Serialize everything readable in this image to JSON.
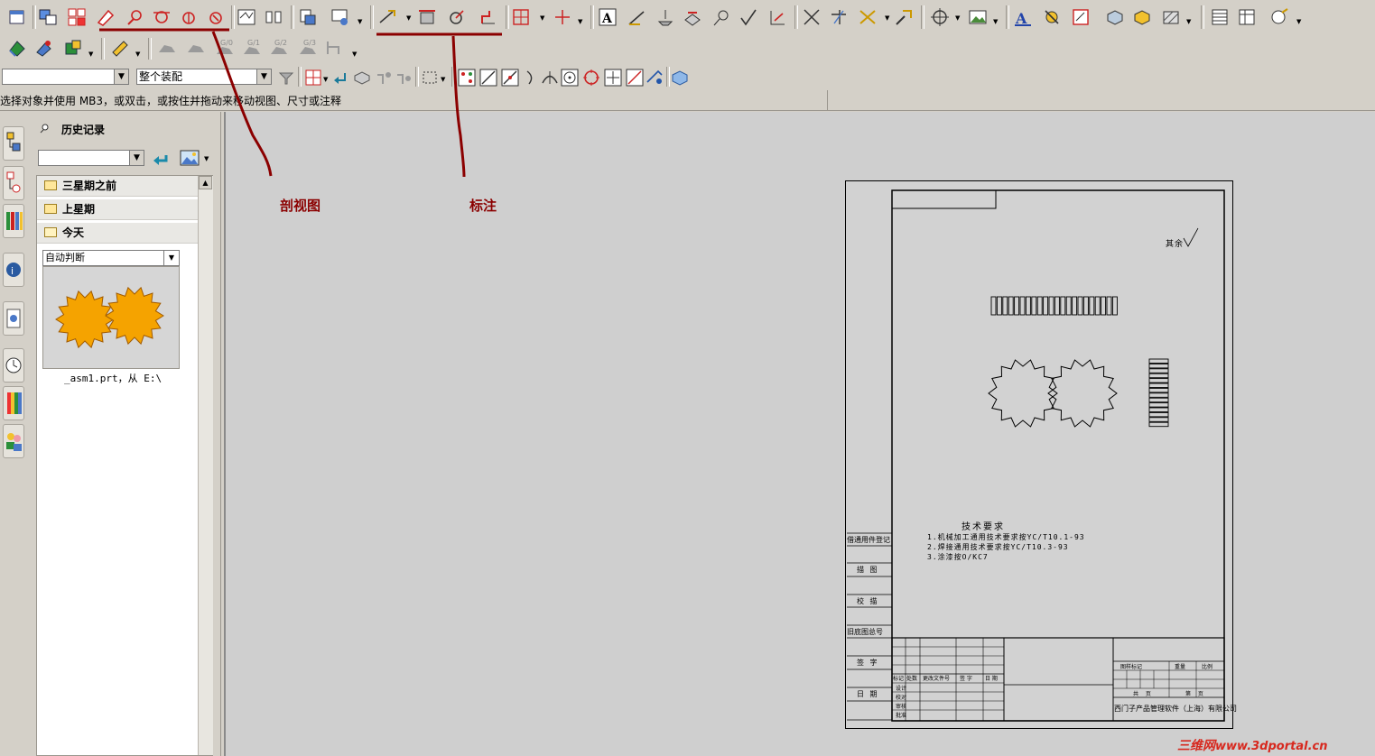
{
  "toolbar": {
    "view_combo_value": "",
    "assembly_combo_value": "整个装配"
  },
  "status": {
    "message": "选择对象并使用 MB3，或双击，或按住并拖动来移动视图、尺寸或注释"
  },
  "history_panel": {
    "title": "历史记录",
    "filter_value": "",
    "folders": [
      {
        "label": "三星期之前"
      },
      {
        "label": "上星期"
      },
      {
        "label": "今天"
      }
    ],
    "preview_mode": "自动判断",
    "preview_caption": "_asm1.prt，从 E:\\"
  },
  "annotations": {
    "section_view_label": "剖视图",
    "dimension_label": "标注",
    "marker_color": "#8b0000"
  },
  "drawing": {
    "surface_finish": "其余",
    "tech_title": "技术要求",
    "tech_lines": [
      "1.机械加工通用技术要求按YC/T10.1-93",
      "2.焊接通用技术要求按YC/T10.3-93",
      "3.涂漆按O/KC7"
    ],
    "left_labels": [
      "借通用件登记",
      "描 图",
      "校 描",
      "旧底图总号",
      "签 字",
      "日 期"
    ],
    "title_block": {
      "header_cells": [
        "标记",
        "处数",
        "更改文件号",
        "签 字",
        "日 期"
      ],
      "role_rows": [
        "设计",
        "校对",
        "审核",
        "批准"
      ],
      "stage_header": "图样标记",
      "weight_header": "重量",
      "scale_header": "比例",
      "sheet_total": "共 页",
      "sheet_no": "第 页",
      "company": "西门子产品管理软件（上海）有限公司"
    }
  },
  "watermark": {
    "text_cn": "三维网",
    "text_url": "www.3dportal.cn",
    "color": "#d7281e"
  },
  "colors": {
    "gear_fill": "#f5a300",
    "gear_stroke": "#a05a00"
  }
}
